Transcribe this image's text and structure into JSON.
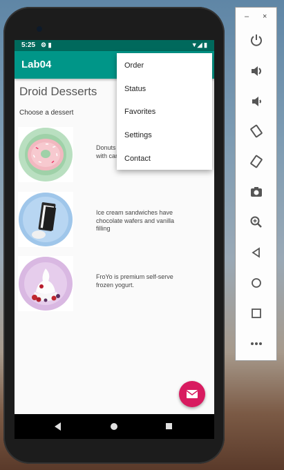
{
  "status": {
    "time": "5:25"
  },
  "app": {
    "title": "Lab04"
  },
  "main": {
    "heading": "Droid Desserts",
    "subheading": "Choose a dessert",
    "desserts": [
      {
        "name": "donut",
        "desc": "Donuts are glazed and sprinkled with candy."
      },
      {
        "name": "ice-cream-sandwich",
        "desc": "Ice cream sandwiches have chocolate wafers and vanilla filling"
      },
      {
        "name": "froyo",
        "desc": "FroYo is premium self-serve frozen yogurt."
      }
    ]
  },
  "menu": {
    "items": [
      {
        "label": "Order"
      },
      {
        "label": "Status"
      },
      {
        "label": "Favorites"
      },
      {
        "label": "Settings"
      },
      {
        "label": "Contact"
      }
    ]
  },
  "toolbar": {
    "minimize": "–",
    "close": "×",
    "buttons": [
      "power-icon",
      "volume-up-icon",
      "volume-down-icon",
      "rotate-left-icon",
      "rotate-right-icon",
      "camera-icon",
      "zoom-icon",
      "back-icon",
      "home-icon",
      "overview-icon",
      "more-icon"
    ]
  },
  "colors": {
    "primary": "#009688",
    "primary_dark": "#00695c",
    "accent": "#d81b60"
  }
}
